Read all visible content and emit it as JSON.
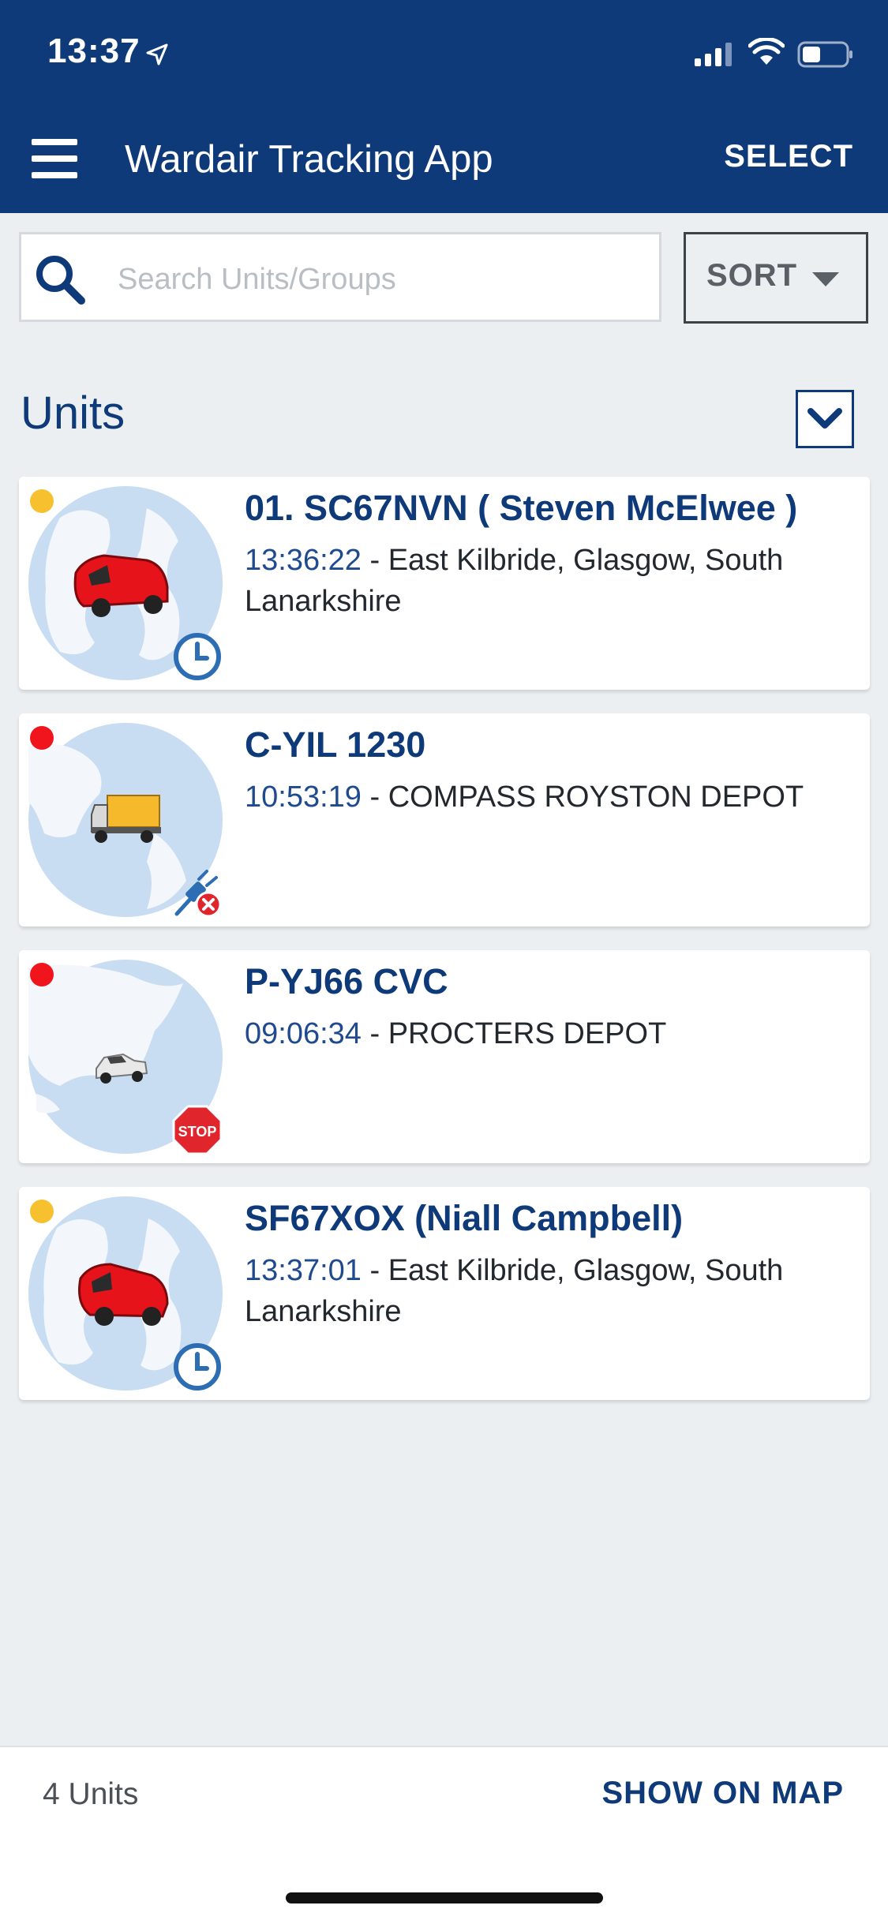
{
  "status_bar": {
    "time": "13:37"
  },
  "app_bar": {
    "title": "Wardair Tracking App",
    "select_label": "SELECT"
  },
  "search": {
    "placeholder": "Search Units/Groups",
    "value": ""
  },
  "sort": {
    "label": "SORT"
  },
  "section": {
    "title": "Units"
  },
  "units": [
    {
      "name": "01. SC67NVN ( Steven McElwee )",
      "time": "13:36:22",
      "location": "East Kilbride, Glasgow, South Lanarkshire",
      "status_color": "#f6c02f",
      "vehicle": "red-van",
      "badge": "clock-icon"
    },
    {
      "name": "C-YIL 1230",
      "time": "10:53:19",
      "location": "COMPASS ROYSTON DEPOT",
      "status_color": "#f0141c",
      "vehicle": "yellow-truck",
      "badge": "unplugged-icon"
    },
    {
      "name": "P-YJ66 CVC",
      "time": "09:06:34",
      "location": "PROCTERS DEPOT",
      "status_color": "#f0141c",
      "vehicle": "white-pickup",
      "badge": "stop-sign-icon",
      "badge_text": "STOP"
    },
    {
      "name": "SF67XOX (Niall Campbell)",
      "time": "13:37:01",
      "location": "East Kilbride, Glasgow, South Lanarkshire",
      "status_color": "#f6c02f",
      "vehicle": "red-van",
      "badge": "clock-icon"
    }
  ],
  "footer": {
    "unit_count": "4 Units",
    "show_map_label": "SHOW ON MAP"
  },
  "colors": {
    "brand": "#0f3a7a",
    "background": "#ebeff1",
    "map_water": "#c8dcf2",
    "map_land": "#f3f6fa"
  }
}
